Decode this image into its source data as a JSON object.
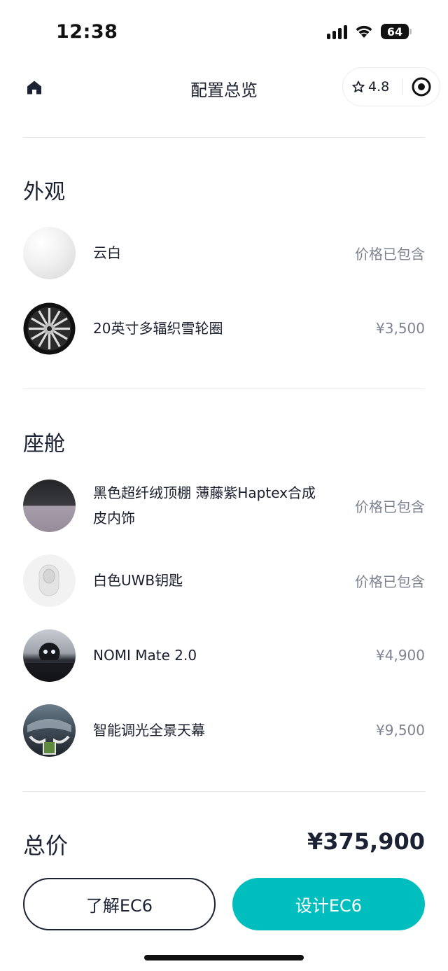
{
  "status": {
    "time": "12:38",
    "battery": "64"
  },
  "nav": {
    "title": "配置总览",
    "rating": "4.8"
  },
  "exterior": {
    "title": "外观",
    "items": [
      {
        "name": "云白",
        "price": "价格已包含"
      },
      {
        "name": "20英寸多辐织雪轮圈",
        "price": "¥3,500"
      }
    ]
  },
  "cabin": {
    "title": "座舱",
    "items": [
      {
        "name": "黑色超纤绒顶棚 薄藤紫Haptex合成皮内饰",
        "price": "价格已包含"
      },
      {
        "name": "白色UWB钥匙",
        "price": "价格已包含"
      },
      {
        "name": "NOMI Mate 2.0",
        "price": "¥4,900"
      },
      {
        "name": "智能调光全景天幕",
        "price": "¥9,500"
      }
    ]
  },
  "total": {
    "label": "总价",
    "value": "¥375,900"
  },
  "actions": {
    "learn_label": "了解EC6",
    "design_label": "设计EC6"
  },
  "colors": {
    "accent": "#00bebe",
    "text": "#1a2233",
    "muted": "#7d8290"
  }
}
